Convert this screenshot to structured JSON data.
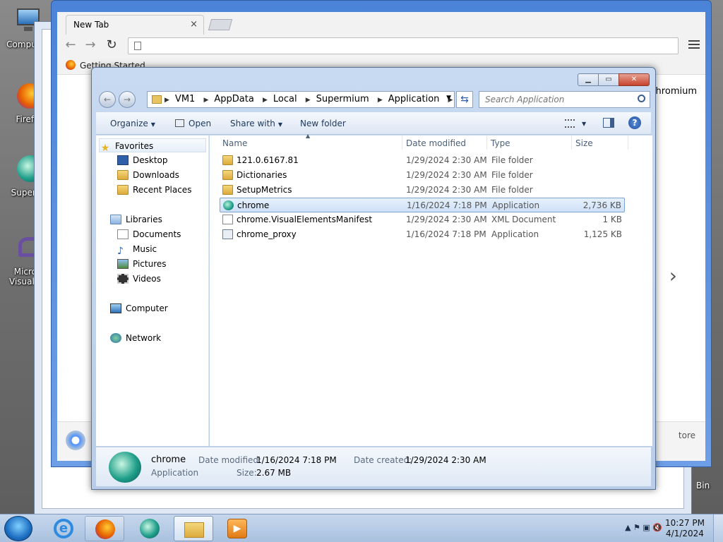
{
  "desktop": {
    "icons": [
      {
        "label": "Computer"
      },
      {
        "label": "Firefo"
      },
      {
        "label": "Superm"
      },
      {
        "label": "Micros"
      },
      {
        "label": "Visual St"
      }
    ],
    "recycle_bin_label": "Bin"
  },
  "browser": {
    "tab_title": "New Tab",
    "close_glyph": "×",
    "bookmark": "Getting Started",
    "page_text_right": "Chromium",
    "chevron": "›",
    "store_text": "tore"
  },
  "explorer": {
    "breadcrumbs": [
      "VM1",
      "AppData",
      "Local",
      "Supermium",
      "Application"
    ],
    "search_placeholder": "Search Application",
    "commands": {
      "organize": "Organize",
      "open": "Open",
      "share_with": "Share with",
      "new_folder": "New folder"
    },
    "nav": {
      "favorites": "Favorites",
      "desktop": "Desktop",
      "downloads": "Downloads",
      "recent_places": "Recent Places",
      "libraries": "Libraries",
      "documents": "Documents",
      "music": "Music",
      "pictures": "Pictures",
      "videos": "Videos",
      "computer": "Computer",
      "network": "Network"
    },
    "columns": {
      "name": "Name",
      "date_modified": "Date modified",
      "type": "Type",
      "size": "Size"
    },
    "files": [
      {
        "name": "121.0.6167.81",
        "date": "1/29/2024 2:30 AM",
        "type": "File folder",
        "size": "",
        "icon": "folder-icon"
      },
      {
        "name": "Dictionaries",
        "date": "1/29/2024 2:30 AM",
        "type": "File folder",
        "size": "",
        "icon": "folder-icon"
      },
      {
        "name": "SetupMetrics",
        "date": "1/29/2024 2:30 AM",
        "type": "File folder",
        "size": "",
        "icon": "folder-icon"
      },
      {
        "name": "chrome",
        "date": "1/16/2024 7:18 PM",
        "type": "Application",
        "size": "2,736 KB",
        "icon": "supermium-app-icon",
        "selected": true
      },
      {
        "name": "chrome.VisualElementsManifest",
        "date": "1/29/2024 2:30 AM",
        "type": "XML Document",
        "size": "1 KB",
        "icon": "xml-document-icon"
      },
      {
        "name": "chrome_proxy",
        "date": "1/16/2024 7:18 PM",
        "type": "Application",
        "size": "1,125 KB",
        "icon": "application-icon"
      }
    ],
    "details": {
      "name": "chrome",
      "kind": "Application",
      "modified_label": "Date modified:",
      "modified_value": "1/16/2024 7:18 PM",
      "size_label": "Size:",
      "size_value": "2.67 MB",
      "created_label": "Date created:",
      "created_value": "1/29/2024 2:30 AM"
    }
  },
  "taskbar": {
    "time": "10:27 PM",
    "date": "4/1/2024",
    "tray_arrow": "▲"
  }
}
